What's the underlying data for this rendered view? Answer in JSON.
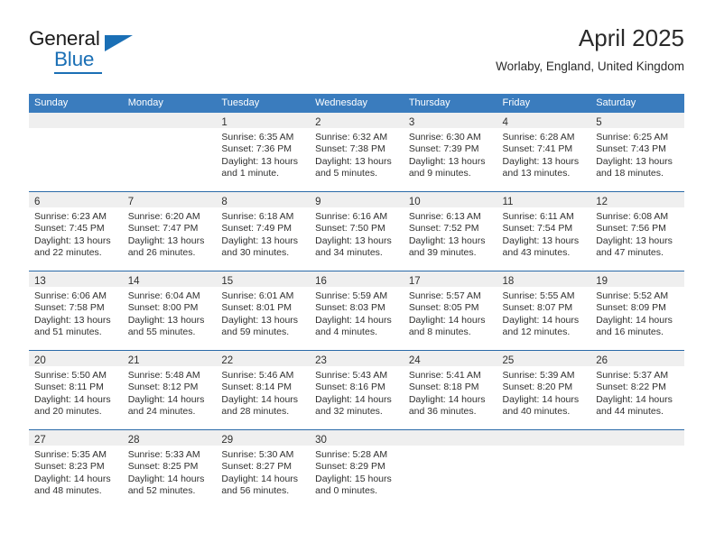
{
  "brand": {
    "name_part1": "General",
    "name_part2": "Blue",
    "triangle_color": "#1a6fb5",
    "accent_color": "#1a6fb5"
  },
  "header": {
    "title": "April 2025",
    "subtitle": "Worlaby, England, United Kingdom"
  },
  "theme": {
    "header_row_bg": "#3a7cbe",
    "header_row_text": "#ffffff",
    "daynum_band_bg": "#efefef",
    "row_divider": "#2a6aa8",
    "body_text": "#30302f"
  },
  "weekday_headers": [
    "Sunday",
    "Monday",
    "Tuesday",
    "Wednesday",
    "Thursday",
    "Friday",
    "Saturday"
  ],
  "labels": {
    "sunrise_prefix": "Sunrise:",
    "sunset_prefix": "Sunset:",
    "daylight_prefix": "Daylight:"
  },
  "weeks": [
    [
      {
        "day": "",
        "empty": true,
        "line1": "",
        "line2": "",
        "line3": "",
        "line4": ""
      },
      {
        "day": "",
        "empty": true,
        "line1": "",
        "line2": "",
        "line3": "",
        "line4": ""
      },
      {
        "day": "1",
        "empty": false,
        "line1": "Sunrise: 6:35 AM",
        "line2": "Sunset: 7:36 PM",
        "line3": "Daylight: 13 hours",
        "line4": "and 1 minute."
      },
      {
        "day": "2",
        "empty": false,
        "line1": "Sunrise: 6:32 AM",
        "line2": "Sunset: 7:38 PM",
        "line3": "Daylight: 13 hours",
        "line4": "and 5 minutes."
      },
      {
        "day": "3",
        "empty": false,
        "line1": "Sunrise: 6:30 AM",
        "line2": "Sunset: 7:39 PM",
        "line3": "Daylight: 13 hours",
        "line4": "and 9 minutes."
      },
      {
        "day": "4",
        "empty": false,
        "line1": "Sunrise: 6:28 AM",
        "line2": "Sunset: 7:41 PM",
        "line3": "Daylight: 13 hours",
        "line4": "and 13 minutes."
      },
      {
        "day": "5",
        "empty": false,
        "line1": "Sunrise: 6:25 AM",
        "line2": "Sunset: 7:43 PM",
        "line3": "Daylight: 13 hours",
        "line4": "and 18 minutes."
      }
    ],
    [
      {
        "day": "6",
        "empty": false,
        "line1": "Sunrise: 6:23 AM",
        "line2": "Sunset: 7:45 PM",
        "line3": "Daylight: 13 hours",
        "line4": "and 22 minutes."
      },
      {
        "day": "7",
        "empty": false,
        "line1": "Sunrise: 6:20 AM",
        "line2": "Sunset: 7:47 PM",
        "line3": "Daylight: 13 hours",
        "line4": "and 26 minutes."
      },
      {
        "day": "8",
        "empty": false,
        "line1": "Sunrise: 6:18 AM",
        "line2": "Sunset: 7:49 PM",
        "line3": "Daylight: 13 hours",
        "line4": "and 30 minutes."
      },
      {
        "day": "9",
        "empty": false,
        "line1": "Sunrise: 6:16 AM",
        "line2": "Sunset: 7:50 PM",
        "line3": "Daylight: 13 hours",
        "line4": "and 34 minutes."
      },
      {
        "day": "10",
        "empty": false,
        "line1": "Sunrise: 6:13 AM",
        "line2": "Sunset: 7:52 PM",
        "line3": "Daylight: 13 hours",
        "line4": "and 39 minutes."
      },
      {
        "day": "11",
        "empty": false,
        "line1": "Sunrise: 6:11 AM",
        "line2": "Sunset: 7:54 PM",
        "line3": "Daylight: 13 hours",
        "line4": "and 43 minutes."
      },
      {
        "day": "12",
        "empty": false,
        "line1": "Sunrise: 6:08 AM",
        "line2": "Sunset: 7:56 PM",
        "line3": "Daylight: 13 hours",
        "line4": "and 47 minutes."
      }
    ],
    [
      {
        "day": "13",
        "empty": false,
        "line1": "Sunrise: 6:06 AM",
        "line2": "Sunset: 7:58 PM",
        "line3": "Daylight: 13 hours",
        "line4": "and 51 minutes."
      },
      {
        "day": "14",
        "empty": false,
        "line1": "Sunrise: 6:04 AM",
        "line2": "Sunset: 8:00 PM",
        "line3": "Daylight: 13 hours",
        "line4": "and 55 minutes."
      },
      {
        "day": "15",
        "empty": false,
        "line1": "Sunrise: 6:01 AM",
        "line2": "Sunset: 8:01 PM",
        "line3": "Daylight: 13 hours",
        "line4": "and 59 minutes."
      },
      {
        "day": "16",
        "empty": false,
        "line1": "Sunrise: 5:59 AM",
        "line2": "Sunset: 8:03 PM",
        "line3": "Daylight: 14 hours",
        "line4": "and 4 minutes."
      },
      {
        "day": "17",
        "empty": false,
        "line1": "Sunrise: 5:57 AM",
        "line2": "Sunset: 8:05 PM",
        "line3": "Daylight: 14 hours",
        "line4": "and 8 minutes."
      },
      {
        "day": "18",
        "empty": false,
        "line1": "Sunrise: 5:55 AM",
        "line2": "Sunset: 8:07 PM",
        "line3": "Daylight: 14 hours",
        "line4": "and 12 minutes."
      },
      {
        "day": "19",
        "empty": false,
        "line1": "Sunrise: 5:52 AM",
        "line2": "Sunset: 8:09 PM",
        "line3": "Daylight: 14 hours",
        "line4": "and 16 minutes."
      }
    ],
    [
      {
        "day": "20",
        "empty": false,
        "line1": "Sunrise: 5:50 AM",
        "line2": "Sunset: 8:11 PM",
        "line3": "Daylight: 14 hours",
        "line4": "and 20 minutes."
      },
      {
        "day": "21",
        "empty": false,
        "line1": "Sunrise: 5:48 AM",
        "line2": "Sunset: 8:12 PM",
        "line3": "Daylight: 14 hours",
        "line4": "and 24 minutes."
      },
      {
        "day": "22",
        "empty": false,
        "line1": "Sunrise: 5:46 AM",
        "line2": "Sunset: 8:14 PM",
        "line3": "Daylight: 14 hours",
        "line4": "and 28 minutes."
      },
      {
        "day": "23",
        "empty": false,
        "line1": "Sunrise: 5:43 AM",
        "line2": "Sunset: 8:16 PM",
        "line3": "Daylight: 14 hours",
        "line4": "and 32 minutes."
      },
      {
        "day": "24",
        "empty": false,
        "line1": "Sunrise: 5:41 AM",
        "line2": "Sunset: 8:18 PM",
        "line3": "Daylight: 14 hours",
        "line4": "and 36 minutes."
      },
      {
        "day": "25",
        "empty": false,
        "line1": "Sunrise: 5:39 AM",
        "line2": "Sunset: 8:20 PM",
        "line3": "Daylight: 14 hours",
        "line4": "and 40 minutes."
      },
      {
        "day": "26",
        "empty": false,
        "line1": "Sunrise: 5:37 AM",
        "line2": "Sunset: 8:22 PM",
        "line3": "Daylight: 14 hours",
        "line4": "and 44 minutes."
      }
    ],
    [
      {
        "day": "27",
        "empty": false,
        "line1": "Sunrise: 5:35 AM",
        "line2": "Sunset: 8:23 PM",
        "line3": "Daylight: 14 hours",
        "line4": "and 48 minutes."
      },
      {
        "day": "28",
        "empty": false,
        "line1": "Sunrise: 5:33 AM",
        "line2": "Sunset: 8:25 PM",
        "line3": "Daylight: 14 hours",
        "line4": "and 52 minutes."
      },
      {
        "day": "29",
        "empty": false,
        "line1": "Sunrise: 5:30 AM",
        "line2": "Sunset: 8:27 PM",
        "line3": "Daylight: 14 hours",
        "line4": "and 56 minutes."
      },
      {
        "day": "30",
        "empty": false,
        "line1": "Sunrise: 5:28 AM",
        "line2": "Sunset: 8:29 PM",
        "line3": "Daylight: 15 hours",
        "line4": "and 0 minutes."
      },
      {
        "day": "",
        "empty": true,
        "line1": "",
        "line2": "",
        "line3": "",
        "line4": ""
      },
      {
        "day": "",
        "empty": true,
        "line1": "",
        "line2": "",
        "line3": "",
        "line4": ""
      },
      {
        "day": "",
        "empty": true,
        "line1": "",
        "line2": "",
        "line3": "",
        "line4": ""
      }
    ]
  ]
}
